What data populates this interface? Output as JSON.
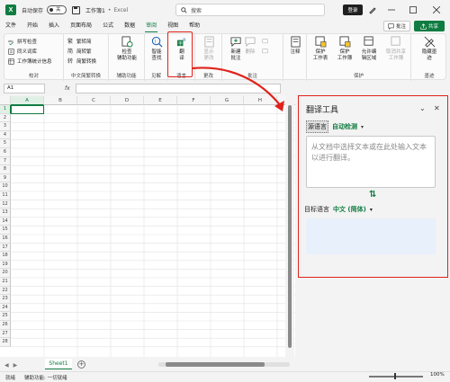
{
  "titlebar": {
    "autosave_label": "自动保存",
    "autosave_state": "关",
    "doc_title": "工作簿1",
    "sep": "•",
    "app_name": "Excel",
    "search_placeholder": "搜索",
    "login_label": "登录"
  },
  "menu": {
    "items": [
      "文件",
      "开始",
      "插入",
      "页面布局",
      "公式",
      "数据",
      "审阅",
      "视图",
      "帮助"
    ],
    "active_index": 6,
    "comment_label": "批注",
    "share_label": "共享"
  },
  "ribbon": {
    "proofing": {
      "items": [
        "拼写检查",
        "同义词库",
        "工作簿统计信息"
      ],
      "label": "校对"
    },
    "chinese": {
      "items": [
        "繁转简",
        "简转繁",
        "简繁转换"
      ],
      "label": "中文简繁转换"
    },
    "accessibility": {
      "button": "检查\n辅助功能",
      "label": "辅助功能"
    },
    "insights": {
      "button": "智能\n查找",
      "label": "见解"
    },
    "language": {
      "button": "翻\n译",
      "label": "语言"
    },
    "changes": {
      "button": "显示\n更改",
      "label": "更改"
    },
    "comments": {
      "buttons": [
        "新建\n批注",
        "删除",
        "上一条",
        "下一条"
      ],
      "label": "批注"
    },
    "notes": {
      "button": "注释",
      "label": ""
    },
    "protect": {
      "buttons": [
        "保护\n工作表",
        "保护\n工作簿",
        "允许编\n辑区域",
        "取消共享\n工作簿"
      ],
      "label": "保护"
    },
    "ink": {
      "button": "隐藏墨\n迹",
      "label": "墨迹"
    }
  },
  "formula": {
    "namebox": "A1",
    "fx": "fx"
  },
  "grid": {
    "columns": [
      "A",
      "B",
      "C",
      "D",
      "E",
      "F",
      "G",
      "H",
      "I"
    ],
    "rows": [
      "1",
      "2",
      "3",
      "4",
      "5",
      "6",
      "7",
      "8",
      "9",
      "10",
      "11",
      "12",
      "13",
      "14",
      "15",
      "16",
      "17",
      "18",
      "19",
      "20",
      "21",
      "22",
      "23",
      "24",
      "25",
      "26",
      "27",
      "28"
    ]
  },
  "sheets": {
    "nav_prev": "◀",
    "nav_next": "▶",
    "active": "Sheet1",
    "add": "+"
  },
  "status": {
    "ready": "就绪",
    "accessibility": "辅助功能: 一切就绪",
    "zoom": "100%"
  },
  "translator": {
    "title": "翻译工具",
    "source_key": "源语言",
    "source_value": "自动检测",
    "source_placeholder": "从文档中选择文本或在此处输入文本以进行翻译。",
    "swap": "⇅",
    "target_key": "目标语言",
    "target_value": "中文 (简体)"
  },
  "colors": {
    "accent": "#107c41",
    "annotation": "#e0221b",
    "target_box": "#e8f0fb"
  }
}
